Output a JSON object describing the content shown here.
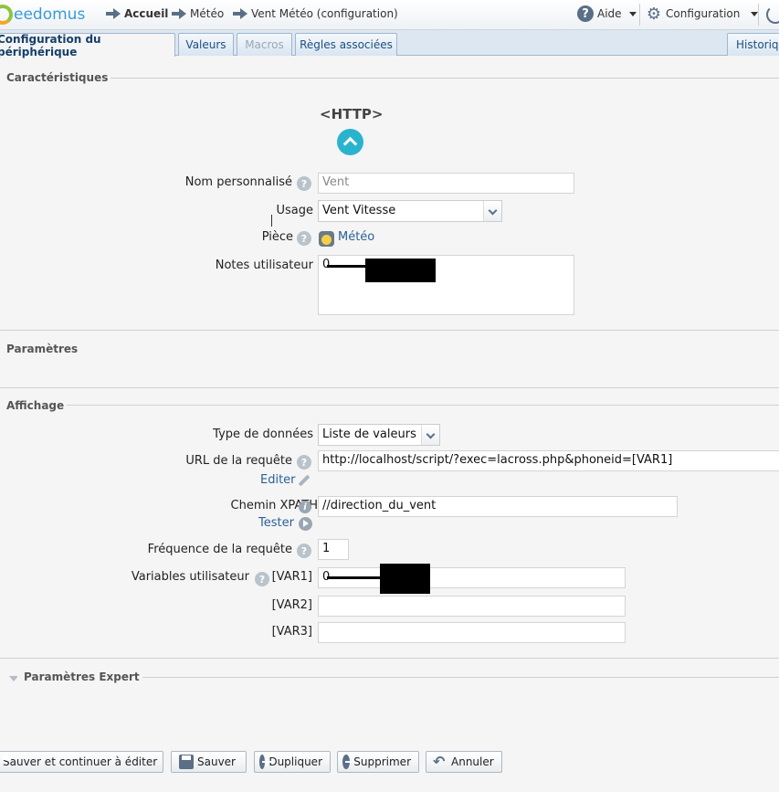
{
  "header": {
    "logo_text": "eedomus",
    "breadcrumb": [
      "Accueil",
      "Météo",
      "Vent Météo (configuration)"
    ],
    "help_label": "Aide",
    "config_label": "Configuration"
  },
  "tabs": [
    {
      "label": "Configuration du périphérique",
      "active": true
    },
    {
      "label": "Valeurs"
    },
    {
      "label": "Macros",
      "disabled": true
    },
    {
      "label": "Règles associées"
    },
    {
      "label": "Historique"
    }
  ],
  "sections": {
    "characteristics": "Caractéristiques",
    "parameters": "Paramètres",
    "display": "Affichage",
    "expert": "Paramètres Expert"
  },
  "device_type": "<HTTP>",
  "characteristics": {
    "custom_name_label": "Nom personnalisé",
    "custom_name_placeholder": "Vent",
    "usage_label": "Usage",
    "usage_value": "Vent Vitesse",
    "room_label": "Pièce",
    "room_value": "Météo",
    "notes_label": "Notes utilisateur",
    "notes_visible_prefix": "0"
  },
  "display": {
    "data_type_label": "Type de données",
    "data_type_value": "Liste de valeurs",
    "url_label": "URL de la requête",
    "url_value": "http://localhost/script/?exec=lacross.php&phoneid=[VAR1]",
    "edit_link": "Editer",
    "xpath_label": "Chemin XPATH",
    "xpath_value": "//direction_du_vent",
    "test_link": "Tester",
    "frequency_label": "Fréquence de la requête",
    "frequency_value": "1",
    "user_vars_label": "Variables utilisateur",
    "var1_label": "[VAR1]",
    "var1_visible_prefix": "0",
    "var2_label": "[VAR2]",
    "var3_label": "[VAR3]"
  },
  "buttons": {
    "save_continue": "Sauver et continuer à éditer",
    "save": "Sauver",
    "duplicate": "Dupliquer",
    "delete": "Supprimer",
    "cancel": "Annuler"
  }
}
